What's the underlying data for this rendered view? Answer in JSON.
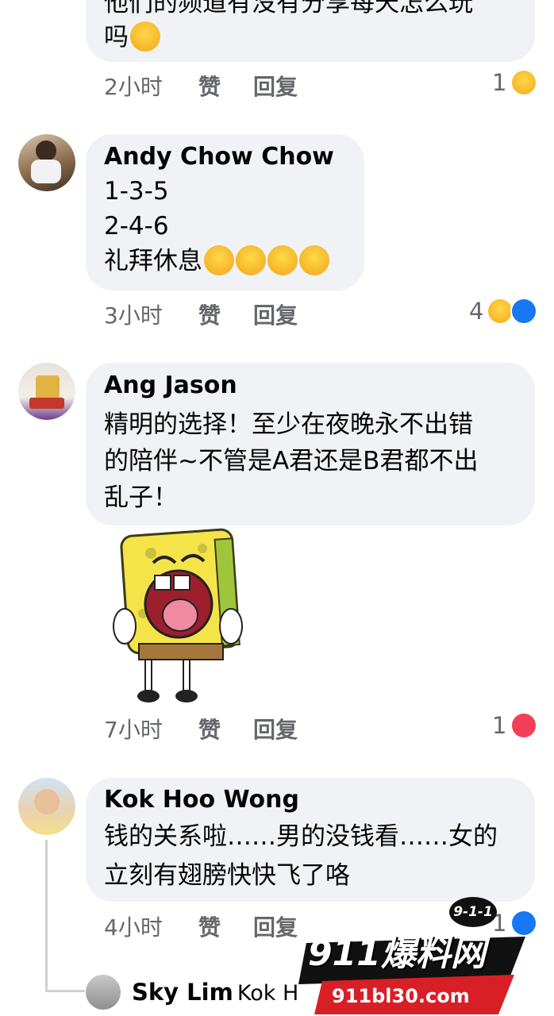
{
  "comments": [
    {
      "name": "",
      "lines": [
        "他们的频道有没有分享每天怎么玩",
        "吗"
      ],
      "emoji_count": 1,
      "time": "2小时",
      "like": "赞",
      "reply": "回复",
      "reaction_count": "1",
      "reactions": [
        "haha"
      ]
    },
    {
      "name": "Andy Chow Chow",
      "lines": [
        "1-3-5",
        "2-4-6",
        "礼拜休息"
      ],
      "emoji_count": 4,
      "time": "3小时",
      "like": "赞",
      "reply": "回复",
      "reaction_count": "4",
      "reactions": [
        "haha",
        "like"
      ]
    },
    {
      "name": "Ang Jason",
      "lines": [
        "精明的选择！至少在夜晚永不出错",
        "的陪伴~不管是A君还是B君都不出",
        "乱子！"
      ],
      "sticker": "spongebob-laughing-sticker",
      "time": "7小时",
      "like": "赞",
      "reply": "回复",
      "reaction_count": "1",
      "reactions": [
        "love"
      ]
    },
    {
      "name": "Kok Hoo Wong",
      "lines": [
        "钱的关系啦……男的没钱看……女的",
        "立刻有翅膀快快飞了咯"
      ],
      "time": "4小时",
      "like": "赞",
      "reply": "回复",
      "reaction_count": "1",
      "reactions": [
        "like"
      ]
    }
  ],
  "reply_preview": {
    "name": "Sky Lim",
    "text": "Kok H"
  },
  "watermark": {
    "brand": "911爆料网",
    "badge": "9-1-1",
    "url": "911bl30.com"
  },
  "colors": {
    "bubble": "#f0f2f5",
    "meta_text": "#65676b",
    "like_blue": "#1877f2",
    "love_red": "#f33e58",
    "haha_yellow": "#f7b125"
  }
}
